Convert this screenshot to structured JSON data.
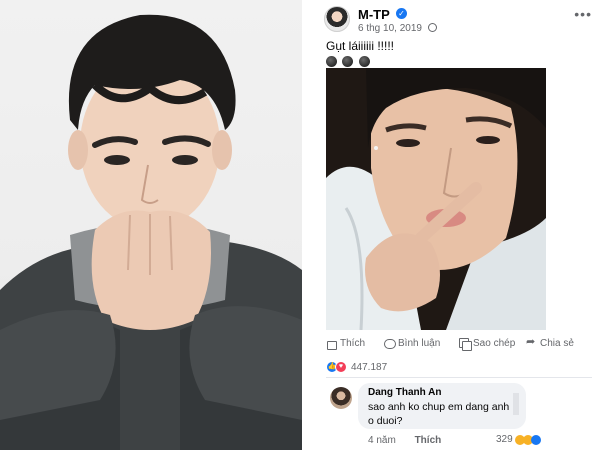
{
  "post": {
    "author": "M-TP",
    "date": "6 thg 10, 2019",
    "more_icon": "•••",
    "text": "Gụt láiiiiii !!!!!",
    "emoji_count": 3,
    "actions": {
      "like": "Thích",
      "comment": "Bình luận",
      "copy": "Sao chép",
      "share": "Chia sẻ"
    },
    "reaction_count": "447.187"
  },
  "comment": {
    "author": "Dang Thanh An",
    "text": "sao anh ko chup em dang anh o duoi?",
    "time": "4 năm",
    "like_label": "Thích",
    "reaction_count": "329"
  },
  "colors": {
    "fb_blue": "#1877f2",
    "love_red": "#f33e58",
    "meta_gray": "#65676b",
    "bubble_bg": "#f0f2f5"
  }
}
